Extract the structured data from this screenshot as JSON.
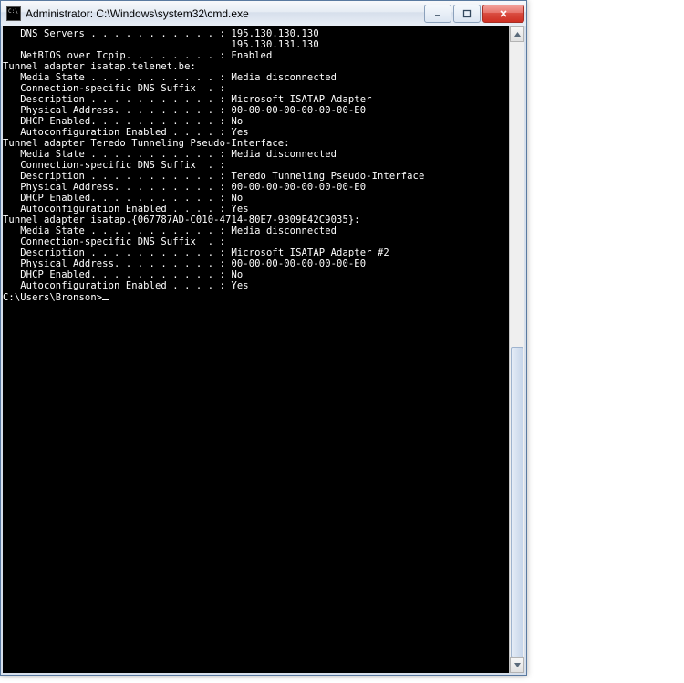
{
  "window": {
    "title": "Administrator: C:\\Windows\\system32\\cmd.exe"
  },
  "top": {
    "dns_label": "   DNS Servers . . . . . . . . . . . : ",
    "dns1": "195.130.130.130",
    "dns2_pad": "                                       ",
    "dns2": "195.130.131.130",
    "netbios_label": "   NetBIOS over Tcpip. . . . . . . . : ",
    "netbios_val": "Enabled"
  },
  "adapter1": {
    "header": "Tunnel adapter isatap.telenet.be:",
    "media_label": "   Media State . . . . . . . . . . . : ",
    "media_val": "Media disconnected",
    "suffix_label": "   Connection-specific DNS Suffix  . :",
    "desc_label": "   Description . . . . . . . . . . . : ",
    "desc_val": "Microsoft ISATAP Adapter",
    "phys_label": "   Physical Address. . . . . . . . . : ",
    "phys_val": "00-00-00-00-00-00-00-E0",
    "dhcp_label": "   DHCP Enabled. . . . . . . . . . . : ",
    "dhcp_val": "No",
    "auto_label": "   Autoconfiguration Enabled . . . . : ",
    "auto_val": "Yes"
  },
  "adapter2": {
    "header": "Tunnel adapter Teredo Tunneling Pseudo-Interface:",
    "media_label": "   Media State . . . . . . . . . . . : ",
    "media_val": "Media disconnected",
    "suffix_label": "   Connection-specific DNS Suffix  . :",
    "desc_label": "   Description . . . . . . . . . . . : ",
    "desc_val": "Teredo Tunneling Pseudo-Interface",
    "phys_label": "   Physical Address. . . . . . . . . : ",
    "phys_val": "00-00-00-00-00-00-00-E0",
    "dhcp_label": "   DHCP Enabled. . . . . . . . . . . : ",
    "dhcp_val": "No",
    "auto_label": "   Autoconfiguration Enabled . . . . : ",
    "auto_val": "Yes"
  },
  "adapter3": {
    "header": "Tunnel adapter isatap.{067787AD-C010-4714-80E7-9309E42C9035}:",
    "media_label": "   Media State . . . . . . . . . . . : ",
    "media_val": "Media disconnected",
    "suffix_label": "   Connection-specific DNS Suffix  . :",
    "desc_label": "   Description . . . . . . . . . . . : ",
    "desc_val": "Microsoft ISATAP Adapter #2",
    "phys_label": "   Physical Address. . . . . . . . . : ",
    "phys_val": "00-00-00-00-00-00-00-E0",
    "dhcp_label": "   DHCP Enabled. . . . . . . . . . . : ",
    "dhcp_val": "No",
    "auto_label": "   Autoconfiguration Enabled . . . . : ",
    "auto_val": "Yes"
  },
  "prompt": "C:\\Users\\Bronson>"
}
